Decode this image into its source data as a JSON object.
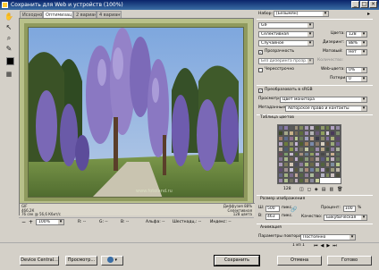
{
  "window": {
    "title": "Сохранить для Web и устройств (100%)",
    "controls": {
      "minimize": "_",
      "maximize": "□",
      "close": "×"
    }
  },
  "tabs": [
    "Исходное",
    "Оптимизация",
    "2 варианта",
    "4 варианта"
  ],
  "preview_info": {
    "left": [
      "GIF",
      "466,2К",
      "76 сек @ 56,6 Кбит/с"
    ],
    "right": [
      "Диффузия 88%",
      "Селективная",
      "128 цвета"
    ]
  },
  "watermark": "www.fotoland.ru",
  "statusbar": {
    "zoom": "100%",
    "r_label": "R: --",
    "g_label": "G: --",
    "b_label": "B: --",
    "alpha_label": "Альфа: --",
    "hex_label": "Шестнадц.: --",
    "index_label": "Индекс: --"
  },
  "settings": {
    "preset_label": "Набор:",
    "preset_value": "[Безымян]",
    "format_value": "GIF",
    "reduction_value": "Селективная",
    "dither_algo_value": "Случайное",
    "colors_label": "Цвета:",
    "colors_value": "128",
    "dither_label": "Дизеринг:",
    "dither_value": "88%",
    "transparency_label": "Прозрачность",
    "matte_label": "Матовый:",
    "matte_value": "Нет",
    "transp_dither_value": "Без дизеринга прозр.",
    "amount_label": "Количество:",
    "interlaced_label": "Чересстрочно",
    "websnap_label": "Web-цвета:",
    "websnap_value": "0%",
    "lossy_label": "Потери:",
    "lossy_value": "0",
    "srgb_label": "Преобразовать в sRGB",
    "preview_label": "Просмотр:",
    "preview_value": "Цвет монитора",
    "metadata_label": "Метаданные:",
    "metadata_value": "Авторское право и контакты"
  },
  "color_table": {
    "title": "Таблица цветов",
    "count": "128",
    "colors": [
      "#6b6a8a",
      "#8a7aa8",
      "#5a5a5a",
      "#9c8f7a",
      "#7f8a5c",
      "#a89ab8",
      "#c2b7c9",
      "#4f5a3a",
      "#8f9a6a",
      "#6e7e4a",
      "#b0a0c0",
      "#948aa6",
      "#3e4a2a",
      "#a4a88a",
      "#c8b28a",
      "#7a6e5a",
      "#5e6e3e",
      "#9a8ab0",
      "#b4b4b4",
      "#6a5a7a",
      "#8e9e5e",
      "#d0c4d8",
      "#4a3a5a",
      "#7c8c6c",
      "#a27c6a",
      "#5c6c8c",
      "#8e6e8e",
      "#b8c890",
      "#6a7a5a",
      "#9e9ebe",
      "#c0a890",
      "#3a3a4a",
      "#8a8a6a",
      "#7e6e9e",
      "#aab07a",
      "#5a4a6a",
      "#b2a2c2",
      "#6c7c3c",
      "#949474",
      "#c4b4d4",
      "#4e5e2e",
      "#a08060",
      "#7a8aaa",
      "#8c7c6c",
      "#d8d0c0",
      "#5e4e3e",
      "#9aaa7a",
      "#6e5e8e",
      "#bcac9c",
      "#4c5c6c",
      "#8a9a4a",
      "#a698b6",
      "#727262",
      "#c6cca6",
      "#5a6a4a",
      "#9c8cac",
      "#b6a686",
      "#3c4c3c",
      "#8e7e9e",
      "#aab49a",
      "#6a4a5a",
      "#7c9c6c",
      "#c8bcd0",
      "#54643a",
      "#a89080",
      "#6e7e8e",
      "#92a262",
      "#b09cc0",
      "#484848",
      "#9a9a8a",
      "#cab090",
      "#5e6e5e",
      "#847494",
      "#a6b68a",
      "#706050",
      "#beaece",
      "#4a5a3a",
      "#8c9c7c",
      "#7a6a5a",
      "#b4a4a4",
      "#5c5c7c",
      "#9eae6e",
      "#c2b2c2",
      "#66765a",
      "#aa9aba",
      "#7c7c5c",
      "#d2c6b6",
      "#4e4e5e",
      "#8a7a9a",
      "#a8b87e",
      "#6a6a4a",
      "#bcb0c4",
      "#52623e",
      "#9e8e7e",
      "#7e8e9e",
      "#b6c68a",
      "#604e70",
      "#a09090",
      "#c6c0d6",
      "#5a5a3a",
      "#8e9e8e",
      "#aa8a7a",
      "#7080a0",
      "#94a474",
      "#b8a8c8",
      "#464c36",
      "#9c9c7c",
      "#c0b8a8",
      "#686888",
      "#a2b282",
      "#7a6a8a",
      "#c4a898",
      "#566646",
      "#908098",
      "#acbc9c",
      "#645464",
      "#b2b2c2",
      "#808c5c",
      "#cec2c2",
      "#4c4c3c",
      "#9888a8",
      "#aebe8e",
      "#6e6e5e",
      "#bcaebc",
      "#58683c",
      "#a4947c",
      "#88889a",
      "#c8d09a"
    ]
  },
  "image_size": {
    "title": "Размер изображения",
    "w_label": "Ш:",
    "w_value": "500",
    "h_label": "В:",
    "h_value": "463",
    "unit": "пикс.",
    "percent_label": "Процент:",
    "percent_value": "100",
    "percent_unit": "%",
    "quality_label": "Качество:",
    "quality_value": "Бикубическая"
  },
  "animation": {
    "title": "Анимация",
    "loop_label": "Параметры повтора:",
    "loop_value": "Постоянно",
    "frame_counter": "1 из 1"
  },
  "footer": {
    "device_central": "Device Central...",
    "preview": "Просмотр...",
    "save": "Сохранить",
    "cancel": "Отмена",
    "done": "Готово"
  }
}
